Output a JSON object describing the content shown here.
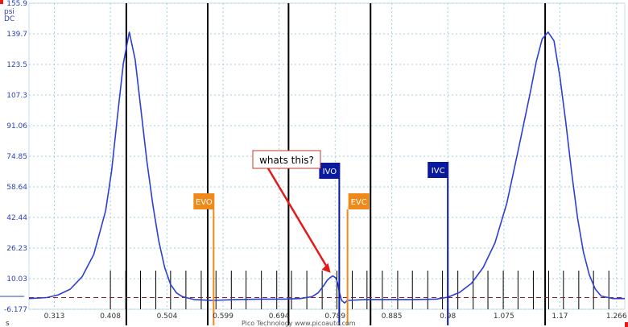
{
  "scope": {
    "units": [
      "psi",
      "DC"
    ],
    "x_unit": "s",
    "footer": "Pico Technology   www.picoauto.com"
  },
  "chart_data": {
    "type": "line",
    "ylabel": "psi",
    "coupling": "DC",
    "xlabel": "s",
    "xlim": [
      0.27,
      1.28
    ],
    "ylim": [
      -10.0,
      155.9
    ],
    "y_ticks": [
      155.9,
      139.7,
      123.5,
      107.3,
      91.06,
      74.85,
      58.64,
      42.44,
      26.23,
      10.03,
      -6.177
    ],
    "x_ticks": [
      0.313,
      0.408,
      0.504,
      0.599,
      0.694,
      0.789,
      0.885,
      0.98,
      1.075,
      1.17,
      1.266
    ],
    "grid": true,
    "series": [
      {
        "color": "#2c3ed6",
        "x": [
          0.27,
          0.3,
          0.32,
          0.34,
          0.36,
          0.38,
          0.4,
          0.41,
          0.42,
          0.43,
          0.44,
          0.45,
          0.46,
          0.47,
          0.48,
          0.49,
          0.5,
          0.51,
          0.52,
          0.53,
          0.55,
          0.58,
          0.62,
          0.66,
          0.7,
          0.73,
          0.75,
          0.76,
          0.77,
          0.775,
          0.78,
          0.785,
          0.79,
          0.793,
          0.796,
          0.8,
          0.805,
          0.81,
          0.84,
          0.88,
          0.92,
          0.96,
          0.98,
          1.0,
          1.02,
          1.04,
          1.06,
          1.08,
          1.1,
          1.12,
          1.13,
          1.14,
          1.15,
          1.16,
          1.17,
          1.18,
          1.19,
          1.2,
          1.21,
          1.22,
          1.23,
          1.24,
          1.26,
          1.28
        ],
        "y": [
          -0.5,
          0.0,
          1.5,
          4.5,
          11.0,
          23.0,
          46.0,
          67.0,
          96.0,
          124.0,
          140.6,
          126.0,
          99.0,
          72.0,
          49.0,
          30.0,
          16.0,
          7.0,
          2.5,
          0.5,
          -1.0,
          -1.5,
          -1.0,
          -0.8,
          -0.8,
          -0.5,
          0.5,
          2.5,
          6.5,
          9.0,
          10.5,
          11.5,
          10.5,
          8.0,
          3.0,
          -1.5,
          -2.8,
          -1.5,
          -1.0,
          -1.0,
          -1.0,
          -0.8,
          0.2,
          2.8,
          7.5,
          16.0,
          29.0,
          50.0,
          79.0,
          109.0,
          125.0,
          137.0,
          140.6,
          136.0,
          117.0,
          93.0,
          66.0,
          42.0,
          24.0,
          12.0,
          4.5,
          0.8,
          -0.5,
          -0.5
        ]
      }
    ],
    "dashed_baseline": {
      "color": "#8b1a1a",
      "y": 0.0
    },
    "cursors": [
      0.435,
      0.573,
      0.71,
      0.849,
      1.145
    ],
    "markers": [
      {
        "label": "EVO",
        "x": 0.583,
        "color": "#f0891a"
      },
      {
        "label": "IVO",
        "x": 0.796,
        "color": "#0a1a9e"
      },
      {
        "label": "EVC",
        "x": 0.81,
        "color": "#f0891a"
      },
      {
        "label": "IVC",
        "x": 0.98,
        "color": "#0a1a9e"
      }
    ],
    "crank_ticks": [
      0.408,
      0.434,
      0.459,
      0.485,
      0.51,
      0.536,
      0.562,
      0.587,
      0.613,
      0.638,
      0.664,
      0.69,
      0.715,
      0.741,
      0.767,
      0.792,
      0.818,
      0.843,
      0.869,
      0.895,
      0.92,
      0.946,
      0.971,
      0.997,
      1.023,
      1.048,
      1.074,
      1.099,
      1.125,
      1.151,
      1.176,
      1.202,
      1.227,
      1.253
    ],
    "annotation": {
      "text": "whats this?",
      "arrow_to": {
        "x": 0.784,
        "y": 11.0
      }
    }
  },
  "colors": {
    "trace": "#2c3ed6",
    "grid": "#9fd0e0",
    "axis_text": "#2a3fb8",
    "cursor": "#000000",
    "arrow": "#e31a1a"
  }
}
